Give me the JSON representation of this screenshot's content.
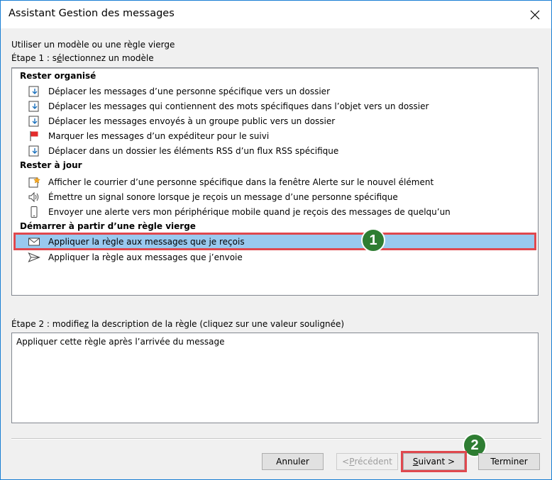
{
  "window": {
    "title": "Assistant Gestion des messages"
  },
  "heading": "Utiliser un modèle ou une règle vierge",
  "step1": {
    "before": "Étape 1 : s",
    "underlined": "é",
    "after": "lectionnez un modèle"
  },
  "groups": [
    {
      "header": "Rester organisé",
      "items": [
        {
          "label": "Déplacer les messages d’une personne spécifique vers un dossier",
          "icon": "move-to-folder-icon"
        },
        {
          "label": "Déplacer les messages qui contiennent des mots spécifiques dans l’objet vers un dossier",
          "icon": "move-to-folder-icon"
        },
        {
          "label": "Déplacer les messages envoyés à un groupe public vers un dossier",
          "icon": "move-to-folder-icon"
        },
        {
          "label": "Marquer les messages d’un expéditeur pour le suivi",
          "icon": "red-flag-icon"
        },
        {
          "label": "Déplacer dans un dossier les éléments RSS d’un flux RSS spécifique",
          "icon": "move-to-folder-icon"
        }
      ]
    },
    {
      "header": "Rester à jour",
      "items": [
        {
          "label": "Afficher le courrier d’une personne spécifique dans la fenêtre Alerte sur le nouvel élément",
          "icon": "alert-window-icon"
        },
        {
          "label": "Émettre un signal sonore lorsque je reçois un message d’une personne spécifique",
          "icon": "speaker-icon"
        },
        {
          "label": "Envoyer une alerte vers mon périphérique mobile quand je reçois des messages de quelqu’un",
          "icon": "mobile-device-icon"
        }
      ]
    },
    {
      "header": "Démarrer à partir d’une règle vierge",
      "items": [
        {
          "label": "Appliquer la règle aux messages que je reçois",
          "icon": "envelope-icon"
        },
        {
          "label": "Appliquer la règle aux messages que j’envoie",
          "icon": "send-arrow-icon"
        }
      ]
    }
  ],
  "step2": {
    "before": "Étape 2 : modifie",
    "underlined": "z",
    "after": " la description de la règle (cliquez sur une valeur soulignée)"
  },
  "description": "Appliquer cette règle après l’arrivée du message",
  "buttons": {
    "cancel": "Annuler",
    "previous": {
      "before": "< ",
      "underlined": "P",
      "after": "récédent"
    },
    "next": {
      "underlined": "S",
      "after": "uivant >"
    },
    "finish": "Terminer"
  },
  "annotations": {
    "badge1": "1",
    "badge2": "2",
    "annotation_color": "#e0484e",
    "badge_color": "#2e7d32",
    "selection_color": "#99c9ef"
  }
}
